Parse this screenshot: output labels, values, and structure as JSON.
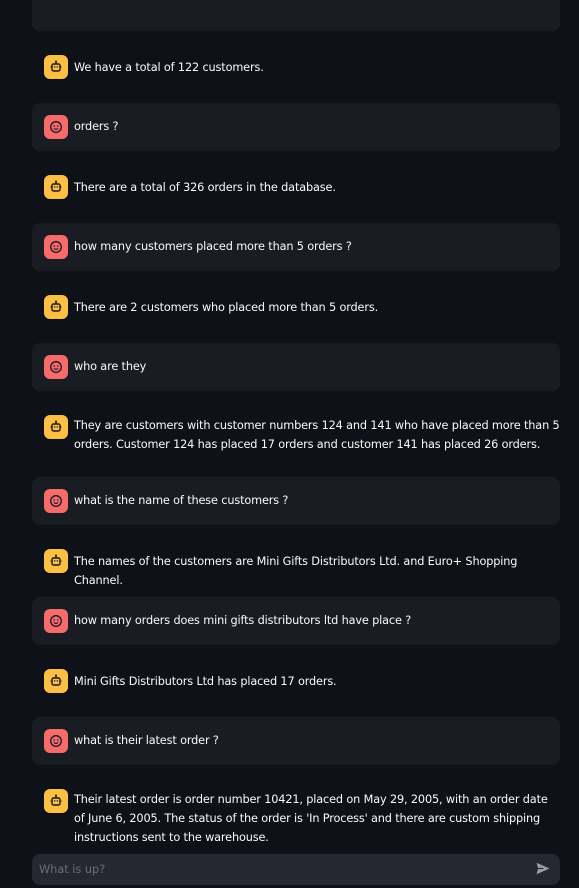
{
  "theme": {
    "background": "#0e1117",
    "user_bubble": "#1a1c24",
    "bot_avatar": "#fbbf45",
    "user_avatar": "#f76b6b",
    "text": "#fafafa",
    "input_background": "#262730"
  },
  "messages": [
    {
      "role": "assistant",
      "avatar_icon": "robot-icon",
      "text": "We have a total of 122 customers."
    },
    {
      "role": "user",
      "avatar_icon": "smiley-face-icon",
      "text": "orders ?"
    },
    {
      "role": "assistant",
      "avatar_icon": "robot-icon",
      "text": "There are a total of 326 orders in the database."
    },
    {
      "role": "user",
      "avatar_icon": "smiley-face-icon",
      "text": "how many customers placed more than 5 orders ?"
    },
    {
      "role": "assistant",
      "avatar_icon": "robot-icon",
      "text": "There are 2 customers who placed more than 5 orders."
    },
    {
      "role": "user",
      "avatar_icon": "smiley-face-icon",
      "text": "who are they"
    },
    {
      "role": "assistant",
      "avatar_icon": "robot-icon",
      "text": "They are customers with customer numbers 124 and 141 who have placed more than 5 orders. Customer 124 has placed 17 orders and customer 141 has placed 26 orders."
    },
    {
      "role": "user",
      "avatar_icon": "smiley-face-icon",
      "text": "what is the name of these customers ?"
    },
    {
      "role": "assistant",
      "avatar_icon": "robot-icon",
      "text": "The names of the customers are Mini Gifts Distributors Ltd. and Euro+ Shopping Channel."
    },
    {
      "role": "user",
      "avatar_icon": "smiley-face-icon",
      "text": "how many orders does mini gifts distributors ltd have place ?"
    },
    {
      "role": "assistant",
      "avatar_icon": "robot-icon",
      "text": "Mini Gifts Distributors Ltd has placed 17 orders."
    },
    {
      "role": "user",
      "avatar_icon": "smiley-face-icon",
      "text": "what is their latest order ?"
    },
    {
      "role": "assistant",
      "avatar_icon": "robot-icon",
      "text": "Their latest order is order number 10421, placed on May 29, 2005, with an order date of June 6, 2005. The status of the order is 'In Process' and there are custom shipping instructions sent to the warehouse."
    }
  ],
  "composer": {
    "placeholder": "What is up?",
    "value": "",
    "send_icon": "send-arrow-icon"
  }
}
